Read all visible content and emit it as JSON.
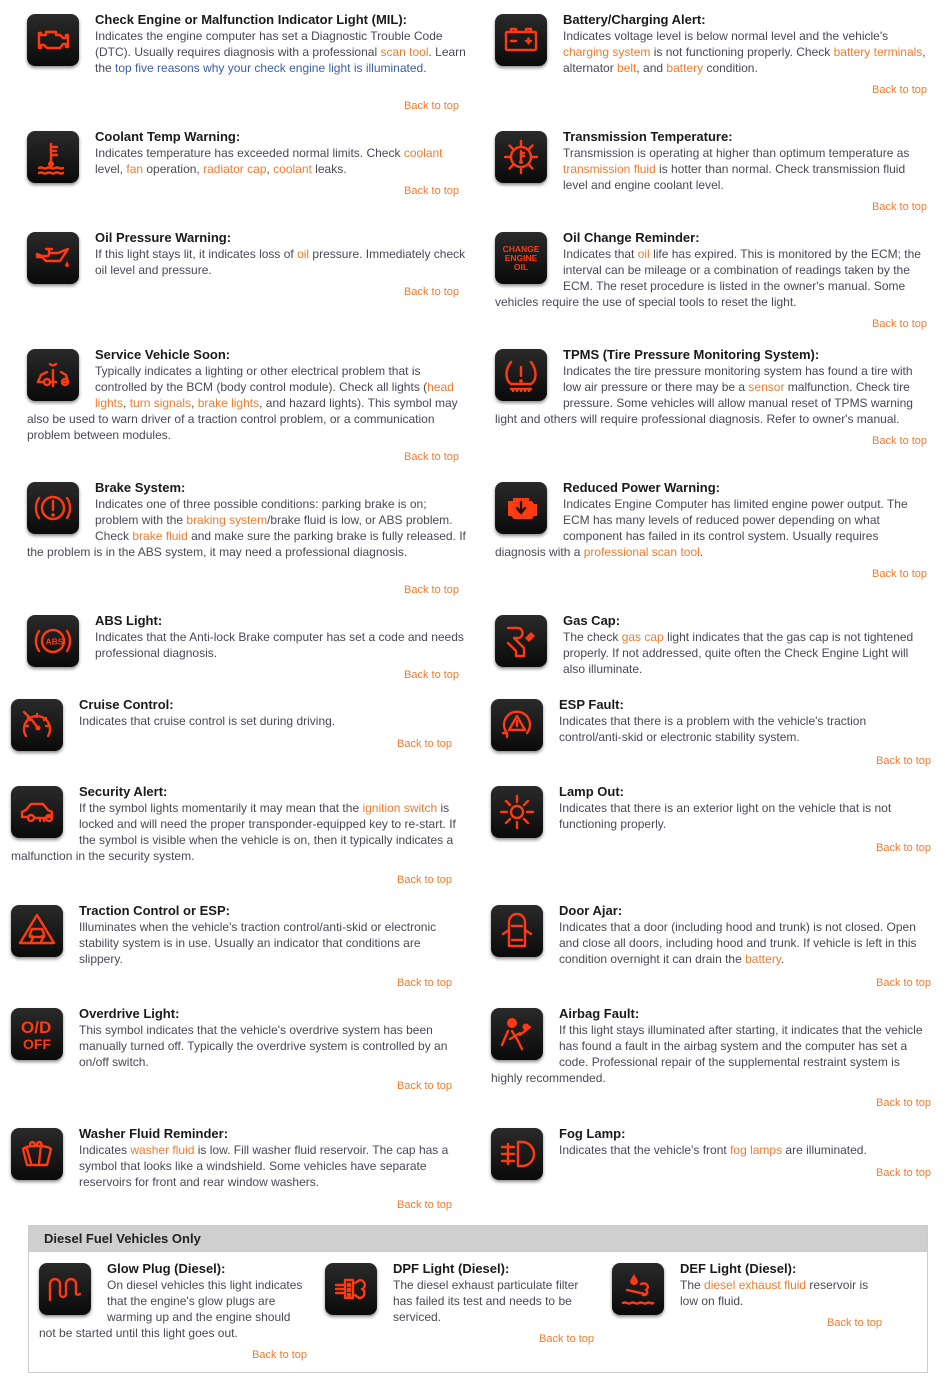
{
  "back_to_top_label": "Back to top",
  "colors": {
    "link": "#f07b2e",
    "link_blue": "#3b5ea8",
    "icon": "#ff3a10",
    "diesel_header_bg": "#cfcfcf"
  },
  "left": [
    {
      "icon": "check-engine-icon",
      "title": "Check Engine or Malfunction Indicator Light (MIL):",
      "parts": [
        {
          "t": "Indicates the engine computer has set a Diagnostic Trouble Code (DTC). Usually requires diagnosis with a professional "
        },
        {
          "link": "scan tool"
        },
        {
          "t": ". Learn the "
        },
        {
          "link_blue": "top five reasons why your check engine light is illuminated"
        },
        {
          "t": "."
        }
      ]
    },
    {
      "icon": "coolant-temp-icon",
      "title": "Coolant Temp Warning:",
      "parts": [
        {
          "t": "Indicates temperature has exceeded normal limits. Check "
        },
        {
          "link": "coolant"
        },
        {
          "t": " level, "
        },
        {
          "link": "fan"
        },
        {
          "t": " operation, "
        },
        {
          "link": "radiator cap"
        },
        {
          "t": ", "
        },
        {
          "link": "coolant"
        },
        {
          "t": " leaks."
        }
      ]
    },
    {
      "icon": "oil-pressure-icon",
      "title": "Oil Pressure Warning:",
      "parts": [
        {
          "t": "If this light stays lit, it indicates loss of "
        },
        {
          "link": "oil"
        },
        {
          "t": " pressure. Immediately check oil level and pressure."
        }
      ]
    },
    {
      "icon": "service-vehicle-icon",
      "title": "Service Vehicle Soon:",
      "parts": [
        {
          "t": "Typically indicates a lighting or other electrical problem that is controlled by the BCM (body control module). Check all lights ("
        },
        {
          "link": "head lights"
        },
        {
          "t": ", "
        },
        {
          "link": "turn signals"
        },
        {
          "t": ", "
        },
        {
          "link": "brake lights"
        },
        {
          "t": ", and hazard lights). This symbol may also be used to warn driver of a traction control problem, or a communication problem between modules."
        }
      ]
    },
    {
      "icon": "brake-system-icon",
      "title": "Brake System:",
      "parts": [
        {
          "t": "Indicates one of three possible conditions: parking brake is on; problem with the "
        },
        {
          "link": "braking system"
        },
        {
          "t": "/brake fluid is low, or ABS problem. Check "
        },
        {
          "link": "brake fluid"
        },
        {
          "t": " and make sure the parking brake is fully released. If the problem is in the ABS system, it may need a professional diagnosis."
        }
      ]
    },
    {
      "icon": "abs-light-icon",
      "title": "ABS Light:",
      "parts": [
        {
          "t": "Indicates that the Anti-lock Brake computer has set a code and needs professional diagnosis."
        }
      ]
    },
    {
      "icon": "cruise-control-icon",
      "title": "Cruise Control:",
      "parts": [
        {
          "t": "Indicates that cruise control is set during driving."
        }
      ]
    },
    {
      "icon": "security-alert-icon",
      "title": "Security Alert:",
      "parts": [
        {
          "t": "If the symbol lights momentarily it may mean that the "
        },
        {
          "link": "ignition switch"
        },
        {
          "t": " is locked and will need the proper transponder-equipped key to re-start. If the symbol is visible when the vehicle is on, then it typically indicates a malfunction in the security system."
        }
      ]
    },
    {
      "icon": "traction-control-icon",
      "title": "Traction Control or ESP:",
      "parts": [
        {
          "t": "Illuminates when the vehicle's traction control/anti-skid or electronic stability system is in use. Usually an indicator that conditions are slippery."
        }
      ]
    },
    {
      "icon": "overdrive-off-icon",
      "title": "Overdrive Light:",
      "parts": [
        {
          "t": "This symbol indicates that the vehicle's overdrive system has been manually turned off. Typically the overdrive system is controlled by an on/off switch."
        }
      ]
    },
    {
      "icon": "washer-fluid-icon",
      "title": "Washer Fluid Reminder:",
      "parts": [
        {
          "t": "Indicates "
        },
        {
          "link": "washer fluid"
        },
        {
          "t": " is low. Fill washer fluid reservoir. The cap has a symbol that looks like a windshield. Some vehicles have separate reservoirs for front and rear window washers."
        }
      ]
    }
  ],
  "right": [
    {
      "icon": "battery-icon",
      "title": "Battery/Charging Alert:",
      "parts": [
        {
          "t": "Indicates voltage level is below normal level and the vehicle's "
        },
        {
          "link": "charging system"
        },
        {
          "t": " is not functioning properly. Check "
        },
        {
          "link": "battery terminals"
        },
        {
          "t": ", alternator "
        },
        {
          "link": "belt"
        },
        {
          "t": ", and "
        },
        {
          "link": "battery"
        },
        {
          "t": " condition."
        }
      ]
    },
    {
      "icon": "transmission-temp-icon",
      "title": "Transmission Temperature:",
      "parts": [
        {
          "t": "Transmission is operating at higher than optimum temperature as "
        },
        {
          "link": "transmission fluid"
        },
        {
          "t": " is hotter than normal. Check transmission fluid level and engine coolant level."
        }
      ]
    },
    {
      "icon": "oil-change-icon",
      "icon_text": [
        "CHANGE",
        "ENGINE",
        "OIL"
      ],
      "title": "Oil Change Reminder:",
      "parts": [
        {
          "t": "Indicates that "
        },
        {
          "link": "oil"
        },
        {
          "t": " life has expired. This is monitored by the ECM; the interval can be mileage or a combination of readings taken by the ECM. The reset procedure is listed in the owner's manual. Some vehicles require the use of special tools to reset the light."
        }
      ]
    },
    {
      "icon": "tpms-icon",
      "title": "TPMS (Tire Pressure Monitoring System):",
      "parts": [
        {
          "t": "Indicates the tire pressure monitoring system has found a tire with low air pressure or there may be a "
        },
        {
          "link": "sensor"
        },
        {
          "t": " malfunction. Check tire pressure. Some vehicles will allow manual reset of TPMS warning light and others will require professional diagnosis. Refer to owner's manual."
        }
      ]
    },
    {
      "icon": "reduced-power-icon",
      "title": "Reduced Power Warning:",
      "parts": [
        {
          "t": "Indicates Engine Computer has limited engine power output. The ECM has many levels of reduced power depending on what component has failed in its control system. Usually requires diagnosis with a "
        },
        {
          "link": "professional scan tool"
        },
        {
          "t": "."
        }
      ]
    },
    {
      "icon": "gas-cap-icon",
      "title": "Gas Cap:",
      "parts": [
        {
          "t": "The check "
        },
        {
          "link": "gas cap"
        },
        {
          "t": " light indicates that the gas cap is not tightened properly. If not addressed, quite often the Check Engine Light will also illuminate."
        }
      ]
    },
    {
      "icon": "esp-fault-icon",
      "title": "ESP Fault:",
      "parts": [
        {
          "t": "Indicates that there is a problem with the vehicle's traction control/anti-skid or electronic stability system."
        }
      ]
    },
    {
      "icon": "lamp-out-icon",
      "title": "Lamp Out:",
      "parts": [
        {
          "t": "Indicates that there is an exterior light on the vehicle that is not functioning properly."
        }
      ]
    },
    {
      "icon": "door-ajar-icon",
      "title": "Door Ajar:",
      "parts": [
        {
          "t": "Indicates that a door (including hood and trunk) is not closed. Open and close all doors, including hood and trunk. If vehicle is left in this condition overnight it can drain the "
        },
        {
          "link": "battery"
        },
        {
          "t": "."
        }
      ]
    },
    {
      "icon": "airbag-fault-icon",
      "title": "Airbag Fault:",
      "parts": [
        {
          "t": "If this light stays illuminated after starting, it indicates that the vehicle has found a fault in the airbag system and the computer has set a code. Professional repair of the supplemental restraint system is highly recommended."
        }
      ]
    },
    {
      "icon": "fog-lamp-icon",
      "title": "Fog Lamp:",
      "parts": [
        {
          "t": "Indicates that the vehicle's front "
        },
        {
          "link": "fog lamps"
        },
        {
          "t": " are illuminated."
        }
      ]
    }
  ],
  "diesel": {
    "heading": "Diesel Fuel Vehicles Only",
    "items": [
      {
        "icon": "glow-plug-icon",
        "title": "Glow Plug (Diesel):",
        "parts": [
          {
            "t": "On diesel vehicles this light indicates that the engine's glow plugs are warming up and the engine should not be started until this light goes out."
          }
        ]
      },
      {
        "icon": "dpf-light-icon",
        "title": "DPF Light (Diesel):",
        "parts": [
          {
            "t": "The diesel exhaust particulate filter has failed its test and needs to be serviced."
          }
        ]
      },
      {
        "icon": "def-light-icon",
        "title": "DEF Light (Diesel):",
        "parts": [
          {
            "t": "The "
          },
          {
            "link": "diesel exhaust fluid"
          },
          {
            "t": " reservoir is low on fluid."
          }
        ]
      }
    ]
  }
}
